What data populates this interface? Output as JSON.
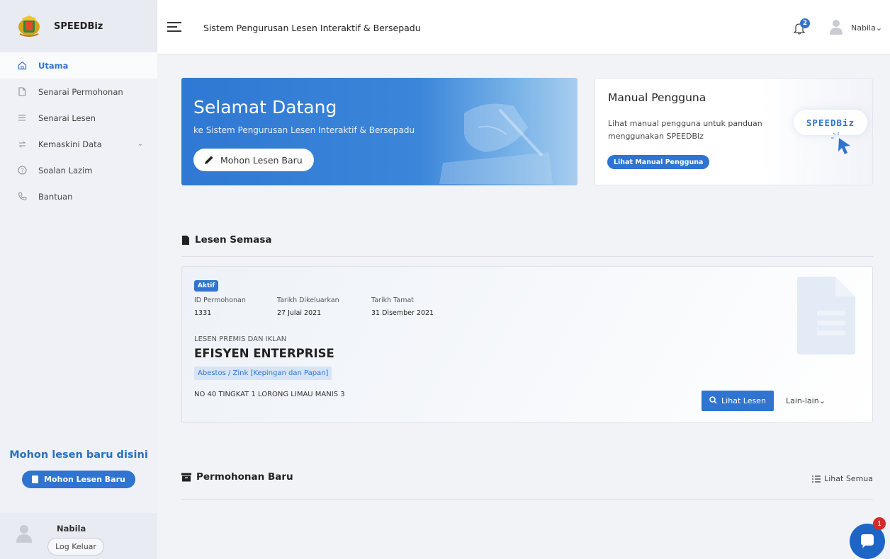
{
  "brand": {
    "name": "SPEEDBiz"
  },
  "sidebar": {
    "items": [
      {
        "label": "Utama",
        "icon": "home-icon",
        "active": true
      },
      {
        "label": "Senarai Permohonan",
        "icon": "file-icon"
      },
      {
        "label": "Senarai Lesen",
        "icon": "list-icon"
      },
      {
        "label": "Kemaskini Data",
        "icon": "refresh-icon",
        "has_submenu": true
      },
      {
        "label": "Soalan Lazim",
        "icon": "help-icon"
      },
      {
        "label": "Bantuan",
        "icon": "phone-icon"
      }
    ],
    "promo_title": "Mohon lesen baru disini",
    "promo_button": "Mohon Lesen Baru",
    "user_name": "Nabila",
    "logout_label": "Log Keluar"
  },
  "header": {
    "title": "Sistem Pengurusan Lesen Interaktif & Bersepadu",
    "notification_count": "2",
    "user_name": "Nabila",
    "user_chevron": "⌄"
  },
  "welcome": {
    "title": "Selamat Datang",
    "subtitle": "ke Sistem Pengurusan Lesen Interaktif & Bersepadu",
    "button": "Mohon Lesen Baru"
  },
  "manual": {
    "title": "Manual Pengguna",
    "text": "Lihat manual pengguna untuk panduan menggunakan SPEEDBiz",
    "button": "Lihat Manual Pengguna",
    "logo_text": "SPEEDBiz"
  },
  "current_license": {
    "section_title": "Lesen Semasa",
    "status": "Aktif",
    "fields": [
      {
        "label": "ID Permohonan",
        "value": "1331"
      },
      {
        "label": "Tarikh Dikeluarkan",
        "value": "27 Julai 2021"
      },
      {
        "label": "Tarikh Tamat",
        "value": "31 Disember 2021"
      }
    ],
    "type": "LESEN PREMIS DAN IKLAN",
    "name": "EFISYEN ENTERPRISE",
    "tag": "Abestos / Zink [Kepingan dan Papan]",
    "address": "NO 40 TINGKAT 1 LORONG LIMAU MANIS 3",
    "view_button": "Lihat Lesen",
    "more_label": "Lain-lain",
    "more_chevron": "⌄"
  },
  "new_applications": {
    "section_title": "Permohonan Baru",
    "view_all": "Lihat Semua"
  },
  "chat": {
    "unread": "1"
  },
  "colors": {
    "accent": "#2f74d0",
    "sidebar_bg": "#f0f1f6",
    "badge_red": "#d42b2b"
  }
}
